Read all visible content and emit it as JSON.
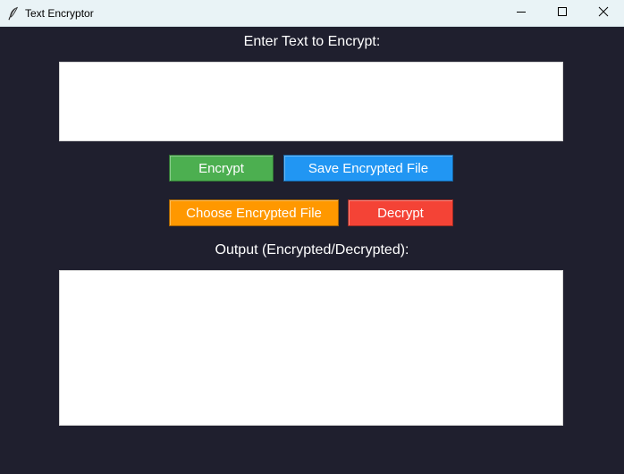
{
  "window": {
    "title": "Text Encryptor",
    "icon": "feather-icon"
  },
  "controls": {
    "minimize": "minimize-icon",
    "maximize": "maximize-icon",
    "close": "close-icon"
  },
  "main": {
    "input_label": "Enter Text to Encrypt:",
    "input_value": "",
    "output_label": "Output (Encrypted/Decrypted):",
    "output_value": ""
  },
  "buttons": {
    "encrypt": {
      "label": "Encrypt",
      "color": "#4caf50"
    },
    "save": {
      "label": "Save Encrypted File",
      "color": "#2196f3"
    },
    "choose": {
      "label": "Choose Encrypted File",
      "color": "#ff9800"
    },
    "decrypt": {
      "label": "Decrypt",
      "color": "#f44336"
    }
  },
  "colors": {
    "background": "#1f1f2e",
    "titlebar": "#e9f3f6",
    "label_text": "#ffffff",
    "textbox": "#ffffff"
  }
}
